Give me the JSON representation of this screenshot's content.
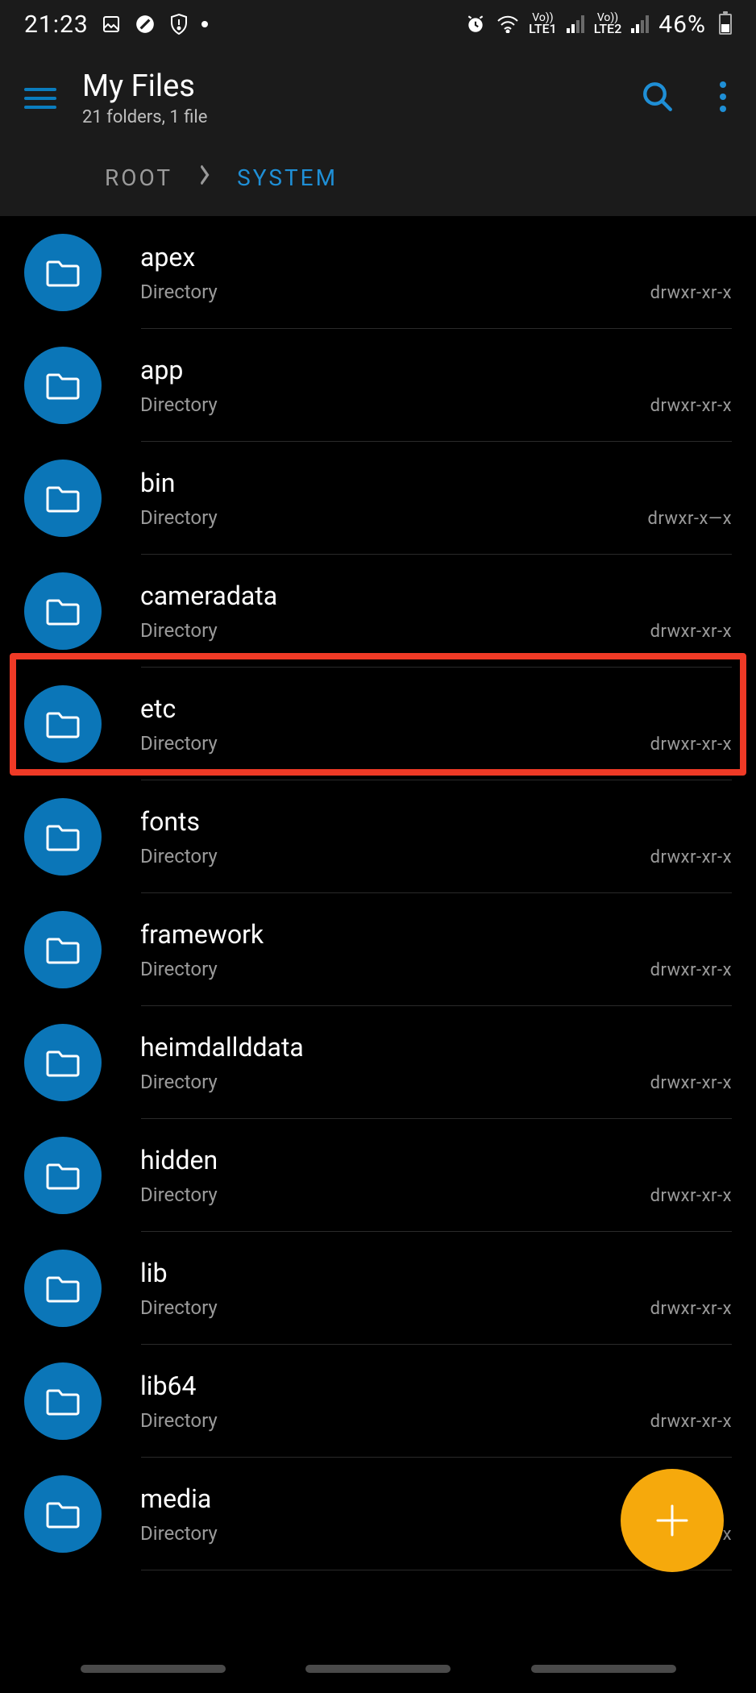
{
  "status": {
    "time": "21:23",
    "battery_percent": "46%"
  },
  "header": {
    "title": "My Files",
    "subtitle": "21 folders, 1 file"
  },
  "breadcrumb": {
    "root": "ROOT",
    "current": "SYSTEM"
  },
  "highlight_index": 2,
  "files": [
    {
      "name": "apex",
      "type": "Directory",
      "perm": "drwxr-xr-x"
    },
    {
      "name": "app",
      "type": "Directory",
      "perm": "drwxr-xr-x"
    },
    {
      "name": "bin",
      "type": "Directory",
      "perm": "drwxr-x—x"
    },
    {
      "name": "cameradata",
      "type": "Directory",
      "perm": "drwxr-xr-x"
    },
    {
      "name": "etc",
      "type": "Directory",
      "perm": "drwxr-xr-x"
    },
    {
      "name": "fonts",
      "type": "Directory",
      "perm": "drwxr-xr-x"
    },
    {
      "name": "framework",
      "type": "Directory",
      "perm": "drwxr-xr-x"
    },
    {
      "name": "heimdallddata",
      "type": "Directory",
      "perm": "drwxr-xr-x"
    },
    {
      "name": "hidden",
      "type": "Directory",
      "perm": "drwxr-xr-x"
    },
    {
      "name": "lib",
      "type": "Directory",
      "perm": "drwxr-xr-x"
    },
    {
      "name": "lib64",
      "type": "Directory",
      "perm": "drwxr-xr-x"
    },
    {
      "name": "media",
      "type": "Directory",
      "perm": "drwxr-xr-x"
    }
  ]
}
